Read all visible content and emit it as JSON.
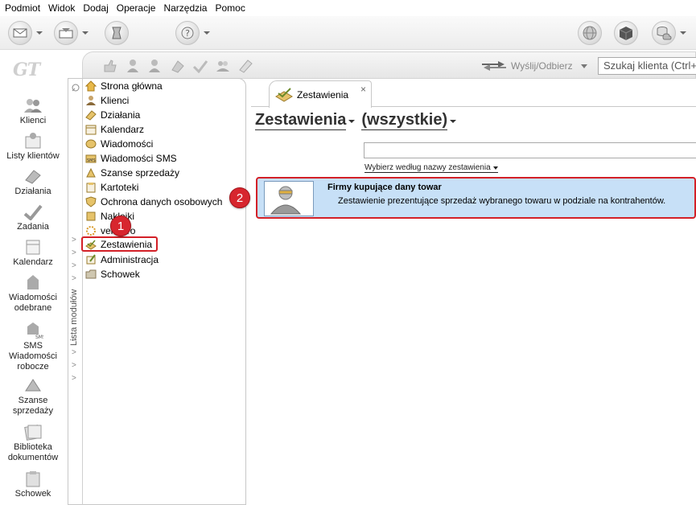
{
  "menu": {
    "items": [
      "Podmiot",
      "Widok",
      "Dodaj",
      "Operacje",
      "Narzędzia",
      "Pomoc"
    ]
  },
  "toolbar": {
    "icons": [
      "send-icon",
      "receive-icon",
      "tools-icon",
      "help-icon",
      "globe-icon",
      "cube-icon",
      "cloud-database-icon"
    ]
  },
  "app": {
    "logo": "GT"
  },
  "leftbar": {
    "items": [
      {
        "label": "Klienci"
      },
      {
        "label": "Listy klientów"
      },
      {
        "label": "Działania"
      },
      {
        "label": "Zadania"
      },
      {
        "label": "Kalendarz"
      },
      {
        "label": "Wiadomości odebrane"
      },
      {
        "label": "SMS Wiadomości robocze"
      },
      {
        "label": "Szanse sprzedaży"
      },
      {
        "label": "Biblioteka dokumentów"
      },
      {
        "label": "Schowek"
      }
    ]
  },
  "subbar": {
    "send_label": "Wyślij/Odbierz",
    "search_placeholder": "Szukaj klienta (Ctrl+"
  },
  "modules": {
    "vertical_label": "Lista modułów",
    "items": [
      {
        "label": "Strona główna"
      },
      {
        "label": "Klienci"
      },
      {
        "label": "Działania"
      },
      {
        "label": "Kalendarz"
      },
      {
        "label": "Wiadomości"
      },
      {
        "label": "Wiadomości SMS"
      },
      {
        "label": "Szanse sprzedaży"
      },
      {
        "label": "Kartoteki"
      },
      {
        "label": "Ochrona danych osobowych"
      },
      {
        "label": "Naklejki"
      },
      {
        "label": "vendero"
      },
      {
        "label": "Zestawienia"
      },
      {
        "label": "Administracja"
      },
      {
        "label": "Schowek"
      }
    ],
    "selected": "Zestawienia"
  },
  "annotations": {
    "badge1": "1",
    "badge2": "2"
  },
  "main": {
    "tab_label": "Zestawienia",
    "tab_close": "×",
    "heading_left": "Zestawienia",
    "heading_right": "(wszystkie)",
    "filter_value": "",
    "filter_hint": "Wybierz według nazwy zestawienia",
    "report": {
      "title": "Firmy kupujące dany towar",
      "description": "Zestawienie prezentujące sprzedaż wybranego towaru w podziale na kontrahentów."
    }
  },
  "colors": {
    "highlight": "#d32027",
    "report_bg": "#c7e0f7",
    "badge": "#d7262e"
  }
}
